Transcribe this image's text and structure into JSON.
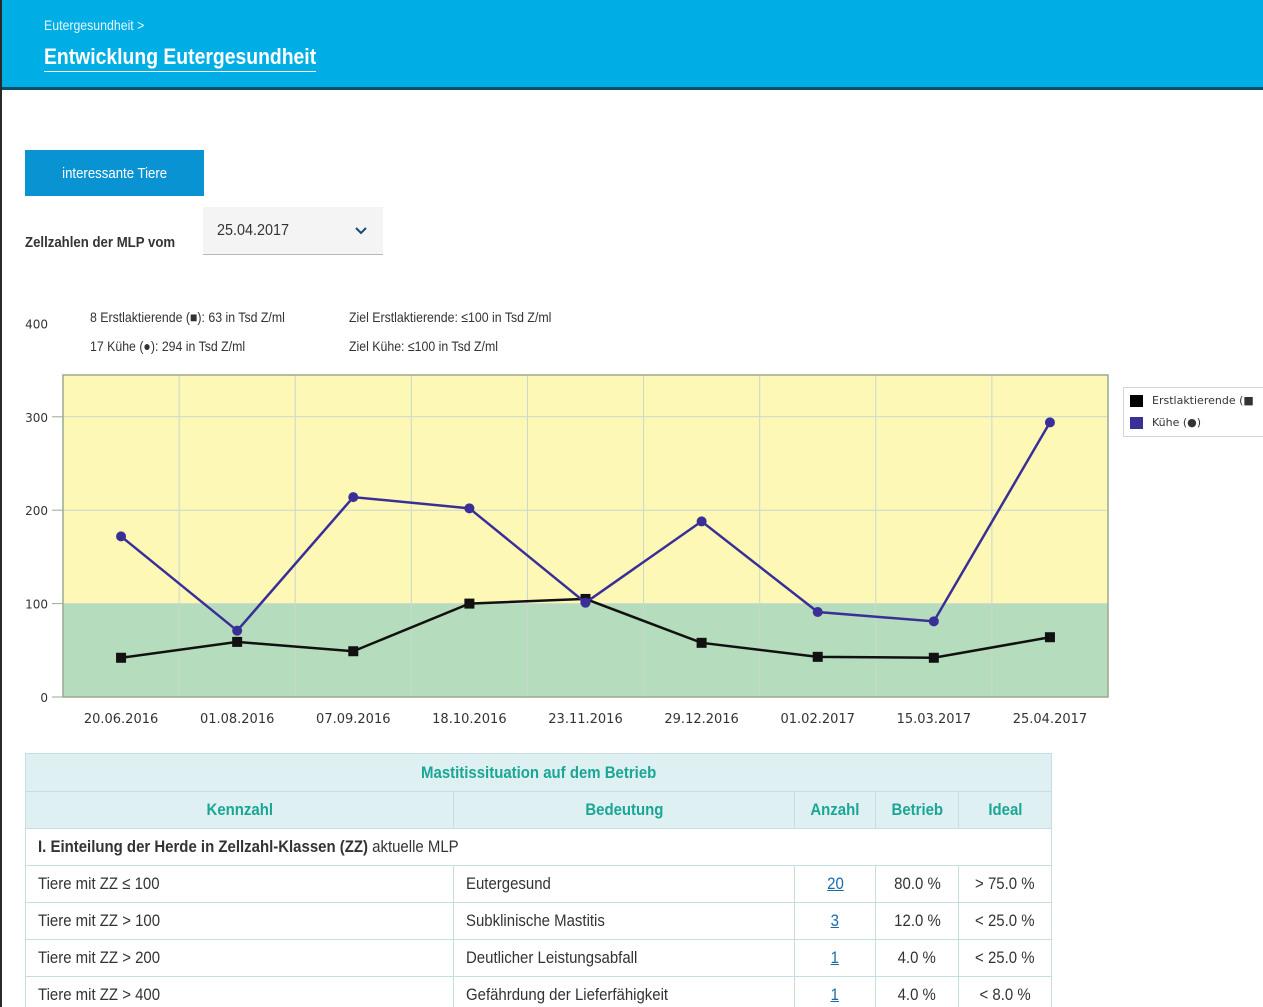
{
  "header": {
    "breadcrumb": "Eutergesundheit >",
    "title": "Entwicklung Eutergesundheit"
  },
  "toolbar": {
    "interesting_button": "interessante Tiere",
    "mlp_label": "Zellzahlen der MLP vom",
    "mlp_date": "25.04.2017"
  },
  "chart_info": {
    "line1_left": "8 Erstlaktierende (■): 63 in Tsd Z/ml",
    "line1_right": "Ziel Erstlaktierende: ≤100 in Tsd Z/ml",
    "line2_left": "17 Kühe (●): 294 in Tsd Z/ml",
    "line2_right": "Ziel Kühe: ≤100 in Tsd Z/ml"
  },
  "chart_data": {
    "type": "line",
    "categories": [
      "20.06.2016",
      "01.08.2016",
      "07.09.2016",
      "18.10.2016",
      "23.11.2016",
      "29.12.2016",
      "01.02.2017",
      "15.03.2017",
      "25.04.2017"
    ],
    "y_ticks": [
      "0",
      "100",
      "200",
      "300",
      "400"
    ],
    "ylim": [
      0,
      400
    ],
    "grid": true,
    "legend_position": "right",
    "bands": [
      {
        "from": 0,
        "to": 100,
        "color": "#b5dcbc"
      },
      {
        "from": 100,
        "to": 400,
        "color": "#fdf8b6"
      }
    ],
    "series": [
      {
        "name": "Erstlaktierende (■",
        "marker": "square",
        "color": "#111111",
        "values": [
          42,
          59,
          49,
          100,
          105,
          58,
          43,
          42,
          64
        ]
      },
      {
        "name": "Kühe (●)",
        "marker": "circle",
        "color": "#3a2f97",
        "values": [
          172,
          71,
          214,
          202,
          101,
          188,
          91,
          81,
          294
        ]
      }
    ]
  },
  "table": {
    "caption": "Mastitissituation auf dem Betrieb",
    "headers": [
      "Kennzahl",
      "Bedeutung",
      "Anzahl",
      "Betrieb",
      "Ideal"
    ],
    "section_title_bold": "I. Einteilung der Herde in Zellzahl-Klassen (ZZ)",
    "section_title_rest": " aktuelle MLP",
    "rows": [
      {
        "kennzahl": "Tiere mit ZZ ≤ 100",
        "bedeutung": "Eutergesund",
        "anzahl": "20",
        "betrieb": "80.0 %",
        "ideal": "> 75.0 %"
      },
      {
        "kennzahl": "Tiere mit ZZ > 100",
        "bedeutung": "Subklinische Mastitis",
        "anzahl": "3",
        "betrieb": "12.0 %",
        "ideal": "< 25.0 %"
      },
      {
        "kennzahl": "Tiere mit ZZ > 200",
        "bedeutung": "Deutlicher Leistungsabfall",
        "anzahl": "1",
        "betrieb": "4.0 %",
        "ideal": "< 25.0 %"
      },
      {
        "kennzahl": "Tiere mit ZZ > 400",
        "bedeutung": "Gefährdung der Lieferfähigkeit",
        "anzahl": "1",
        "betrieb": "4.0 %",
        "ideal": "< 8.0 %"
      }
    ]
  }
}
